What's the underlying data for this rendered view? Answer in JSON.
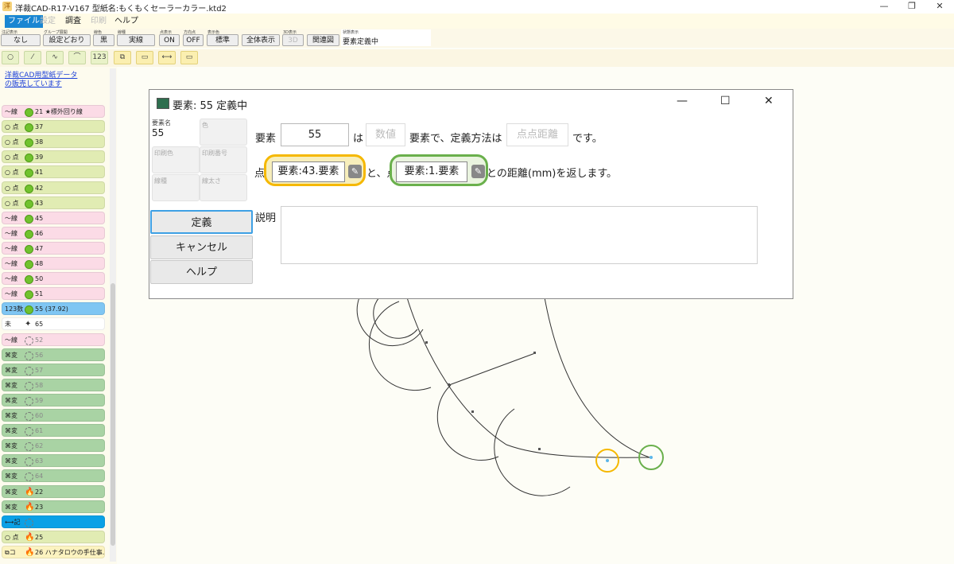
{
  "window": {
    "title": "洋裁CAD-R17-V167 型紙名:もくもくセーラーカラー.ktd2",
    "minimize": "—",
    "restore": "❐",
    "close": "✕"
  },
  "menu": {
    "file": "ファイル",
    "settings": "設定",
    "investigate": "調査",
    "print": "印刷",
    "help": "ヘルプ"
  },
  "toolbar": {
    "note_cap": "注記表示",
    "note": "なし",
    "group_cap": "グループ展開",
    "group": "設定どおり",
    "color_cap": "線色",
    "color": "黒",
    "linetype_cap": "線種",
    "linetype": "実線",
    "point_cap": "点表示",
    "point": "ON",
    "dir_cap": "方向点",
    "dir": "OFF",
    "disp_cap": "表示色",
    "disp": "標準",
    "fit": "全体表示",
    "threed_cap": "3D表示",
    "threed": "3D",
    "related": "関連図",
    "status_cap": "状態表示",
    "status": "要素定義中"
  },
  "iconbar": {
    "i1": "○",
    "i2": "⁄",
    "i3": "∿",
    "i4": "⌒",
    "i5": "123",
    "i6": "⧉",
    "i7": "▭",
    "i8": "⟷",
    "i9": "▭"
  },
  "promo": {
    "line1": "洋裁CAD用型紙データ",
    "line2": "の販売しています"
  },
  "elements": [
    {
      "type": "〜線",
      "label": "21 ★標外回り線",
      "color": "p",
      "dot": "green"
    },
    {
      "type": "○ 点",
      "label": "37",
      "color": "y",
      "dot": "green"
    },
    {
      "type": "○ 点",
      "label": "38",
      "color": "y",
      "dot": "green"
    },
    {
      "type": "○ 点",
      "label": "39",
      "color": "y",
      "dot": "green"
    },
    {
      "type": "○ 点",
      "label": "41",
      "color": "y",
      "dot": "green"
    },
    {
      "type": "○ 点",
      "label": "42",
      "color": "y",
      "dot": "green"
    },
    {
      "type": "○ 点",
      "label": "43",
      "color": "y",
      "dot": "green"
    },
    {
      "type": "〜線",
      "label": "45",
      "color": "p",
      "dot": "green"
    },
    {
      "type": "〜線",
      "label": "46",
      "color": "p",
      "dot": "green"
    },
    {
      "type": "〜線",
      "label": "47",
      "color": "p",
      "dot": "green"
    },
    {
      "type": "〜線",
      "label": "48",
      "color": "p",
      "dot": "green"
    },
    {
      "type": "〜線",
      "label": "50",
      "color": "p",
      "dot": "green"
    },
    {
      "type": "〜線",
      "label": "51",
      "color": "p",
      "dot": "green"
    },
    {
      "type": "123数",
      "label": "55 (37.92)",
      "color": "b",
      "dot": "green"
    },
    {
      "type": " 未",
      "label": "65",
      "color": "w",
      "dot": "star"
    },
    {
      "type": "〜線",
      "label": "52",
      "color": "p",
      "dot": "gray"
    },
    {
      "type": "⌘変",
      "label": "56",
      "color": "g",
      "dot": "gray"
    },
    {
      "type": "⌘変",
      "label": "57",
      "color": "g",
      "dot": "gray"
    },
    {
      "type": "⌘変",
      "label": "58",
      "color": "g",
      "dot": "gray"
    },
    {
      "type": "⌘変",
      "label": "59",
      "color": "g",
      "dot": "gray"
    },
    {
      "type": "⌘変",
      "label": "60",
      "color": "g",
      "dot": "gray"
    },
    {
      "type": "⌘変",
      "label": "61",
      "color": "g",
      "dot": "gray"
    },
    {
      "type": "⌘変",
      "label": "62",
      "color": "g",
      "dot": "gray"
    },
    {
      "type": "⌘変",
      "label": "63",
      "color": "g",
      "dot": "gray"
    },
    {
      "type": "⌘変",
      "label": "64",
      "color": "g",
      "dot": "gray"
    },
    {
      "type": "⌘変",
      "label": "22",
      "color": "g",
      "dot": "fire"
    },
    {
      "type": "⌘変",
      "label": "23",
      "color": "g",
      "dot": "fire"
    },
    {
      "type": "⟷記",
      "label": "",
      "color": "sel",
      "dot": "gray"
    },
    {
      "type": "○ 点",
      "label": "25",
      "color": "y",
      "dot": "fire"
    },
    {
      "type": "⧉コ",
      "label": "26 ハナタロウの手仕事...",
      "color": "c",
      "dot": "fire"
    }
  ],
  "dialog": {
    "title": "要素: 55 定義中",
    "name_cap": "要素名",
    "name_val": "55",
    "color_cap": "色",
    "print_color_cap": "印刷色",
    "print_no_cap": "印刷番号",
    "linetype_cap": "線種",
    "thickness_cap": "線太さ",
    "define": "定義",
    "cancel": "キャンセル",
    "help": "ヘルプ",
    "s1a": "要素",
    "elem_no": "55",
    "s1b": "は",
    "type_val": "数値",
    "s1c": "要素で、定義方法は",
    "method": "点点距離",
    "s1d": "です。",
    "s2a": "点",
    "p1": "要素:43.要素",
    "s2b": "と、点",
    "p2": "要素:1.要素",
    "s2c": "との距離(mm)を返します。",
    "desc_label": "説明",
    "minimize": "—",
    "maximize": "☐",
    "close": "✕"
  }
}
